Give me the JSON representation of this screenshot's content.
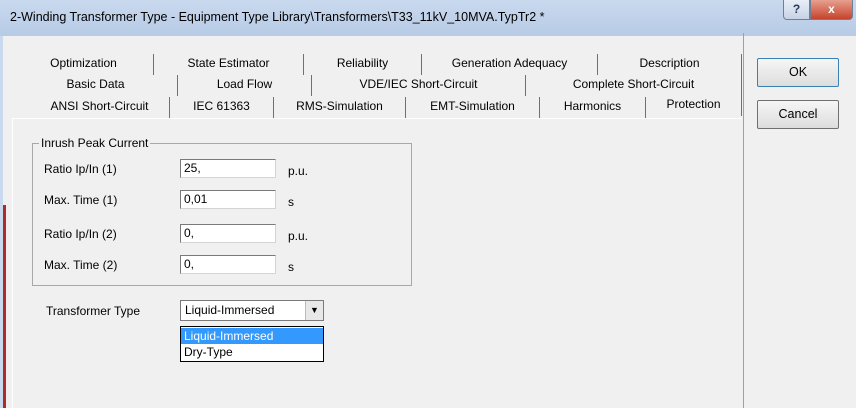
{
  "window": {
    "title": "2-Winding Transformer Type - Equipment Type Library\\Transformers\\T33_11kV_10MVA.TypTr2 *",
    "help_label": "?",
    "close_label": "x"
  },
  "tabs": {
    "row1": [
      "Optimization",
      "State Estimator",
      "Reliability",
      "Generation Adequacy",
      "Description"
    ],
    "row2": [
      "Basic Data",
      "Load Flow",
      "VDE/IEC Short-Circuit",
      "Complete Short-Circuit"
    ],
    "row3": [
      "ANSI Short-Circuit",
      "IEC 61363",
      "RMS-Simulation",
      "EMT-Simulation",
      "Harmonics",
      "Protection"
    ],
    "active": "Protection"
  },
  "inrush": {
    "legend": "Inrush Peak Current",
    "fields": [
      {
        "label": "Ratio Ip/In (1)",
        "value": "25,",
        "unit": "p.u."
      },
      {
        "label": "Max. Time (1)",
        "value": "0,01",
        "unit": "s"
      },
      {
        "label": "Ratio Ip/In (2)",
        "value": "0,",
        "unit": "p.u."
      },
      {
        "label": "Max. Time (2)",
        "value": "0,",
        "unit": "s"
      }
    ]
  },
  "transformer_type": {
    "label": "Transformer Type",
    "selected": "Liquid-Immersed",
    "options": [
      "Liquid-Immersed",
      "Dry-Type"
    ],
    "arrow": "▼"
  },
  "buttons": {
    "ok": "OK",
    "cancel": "Cancel"
  }
}
